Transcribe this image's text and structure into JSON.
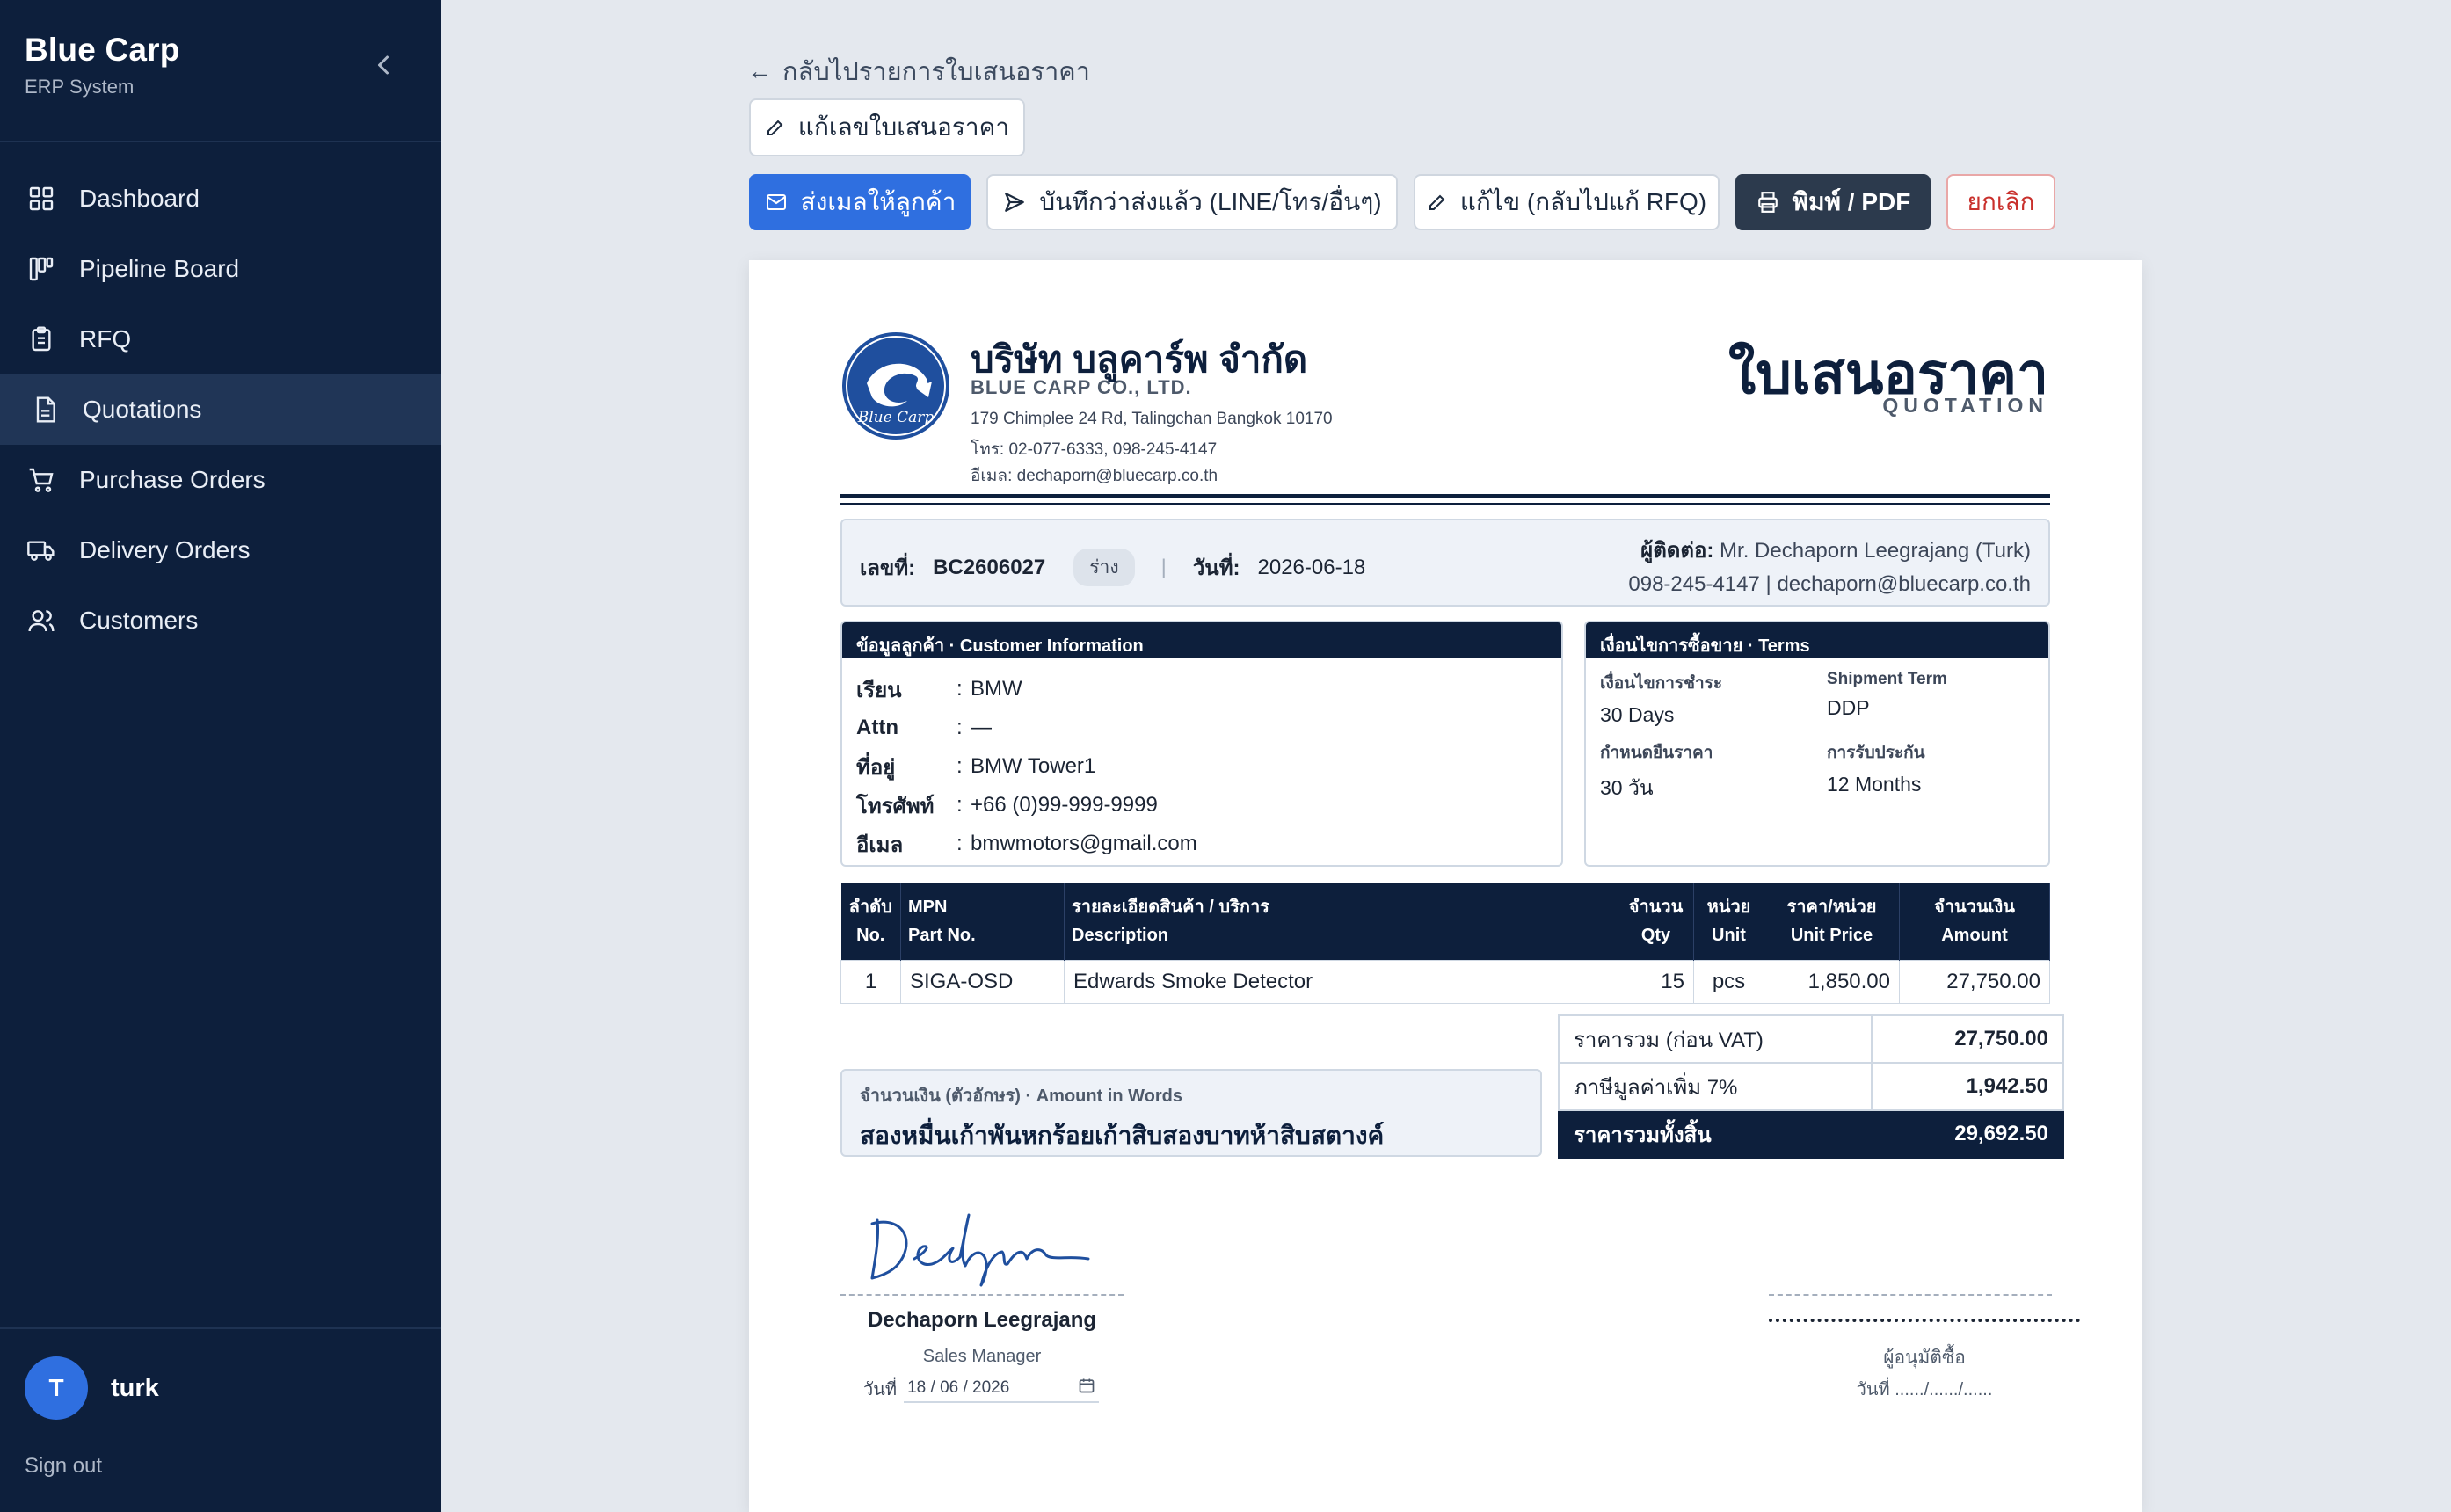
{
  "sidebar": {
    "brand": "Blue Carp",
    "subtitle": "ERP System",
    "items": [
      {
        "label": "Dashboard",
        "icon": "grid-icon"
      },
      {
        "label": "Pipeline Board",
        "icon": "kanban-icon"
      },
      {
        "label": "RFQ",
        "icon": "clipboard-icon"
      },
      {
        "label": "Quotations",
        "icon": "document-icon",
        "active": true
      },
      {
        "label": "Purchase Orders",
        "icon": "cart-icon"
      },
      {
        "label": "Delivery Orders",
        "icon": "truck-icon"
      },
      {
        "label": "Customers",
        "icon": "users-icon"
      }
    ],
    "user": {
      "initial": "T",
      "name": "turk"
    },
    "sign_out": "Sign out"
  },
  "toolbar": {
    "back": "กลับไปรายการใบเสนอราคา",
    "edit_number": "แก้เลขใบเสนอราคา",
    "send_email": "ส่งเมลให้ลูกค้า",
    "mark_sent": "บันทึกว่าส่งแล้ว (LINE/โทร/อื่นๆ)",
    "revise": "แก้ไข (กลับไปแก้ RFQ)",
    "print": "พิมพ์ / PDF",
    "cancel": "ยกเลิก"
  },
  "colors": {
    "navy": "#0d1f3c",
    "primary": "#2f6fe0",
    "danger": "#c9302c"
  },
  "company": {
    "logo_text": "Blue Carp",
    "name_th": "บริษัท บลูคาร์พ จำกัด",
    "name_en": "BLUE CARP CO., LTD.",
    "address": "179 Chimplee 24 Rd, Talingchan Bangkok 10170",
    "phone": "โทร: 02-077-6333, 098-245-4147",
    "email": "อีเมล: dechaporn@bluecarp.co.th"
  },
  "document": {
    "title_th": "ใบเสนอราคา",
    "title_en": "QUOTATION"
  },
  "meta": {
    "no_label": "เลขที่:",
    "no": "BC2606027",
    "status": "ร่าง",
    "date_label": "วันที่:",
    "date": "2026-06-18",
    "contact_label": "ผู้ติดต่อ:",
    "contact_name": "Mr. Dechaporn Leegrajang (Turk)",
    "contact_phone": "098-245-4147",
    "contact_sep": "|",
    "contact_email": "dechaporn@bluecarp.co.th"
  },
  "customer": {
    "heading": "ข้อมูลลูกค้า · Customer Information",
    "rows": [
      {
        "k": "เรียน",
        "v": "BMW"
      },
      {
        "k": "Attn",
        "v": "—"
      },
      {
        "k": "ที่อยู่",
        "v": "BMW Tower1"
      },
      {
        "k": "โทรศัพท์",
        "v": "+66 (0)99-999-9999"
      },
      {
        "k": "อีเมล",
        "v": "bmwmotors@gmail.com"
      }
    ]
  },
  "terms": {
    "heading": "เงื่อนไขการซื้อขาย · Terms",
    "payment_label": "เงื่อนไขการชำระ",
    "payment": "30 Days",
    "shipment_label": "Shipment Term",
    "shipment": "DDP",
    "validity_label": "กำหนดยืนราคา",
    "validity": "30 วัน",
    "warranty_label": "การรับประกัน",
    "warranty": "12 Months"
  },
  "items": {
    "headers": [
      {
        "th": "ลำดับ",
        "en": "No."
      },
      {
        "th": "MPN",
        "en": "Part No."
      },
      {
        "th": "รายละเอียดสินค้า / บริการ",
        "en": "Description"
      },
      {
        "th": "จำนวน",
        "en": "Qty"
      },
      {
        "th": "หน่วย",
        "en": "Unit"
      },
      {
        "th": "ราคา/หน่วย",
        "en": "Unit Price"
      },
      {
        "th": "จำนวนเงิน",
        "en": "Amount"
      }
    ],
    "rows": [
      {
        "no": "1",
        "mpn": "SIGA-OSD",
        "desc": "Edwards Smoke Detector",
        "qty": "15",
        "unit": "pcs",
        "price": "1,850.00",
        "amount": "27,750.00"
      }
    ]
  },
  "words": {
    "label": "จำนวนเงิน (ตัวอักษร) · Amount in Words",
    "value": "สองหมื่นเก้าพันหกร้อยเก้าสิบสองบาทห้าสิบสตางค์"
  },
  "totals": {
    "subtotal_label": "ราคารวม (ก่อน VAT)",
    "subtotal": "27,750.00",
    "vat_label": "ภาษีมูลค่าเพิ่ม 7%",
    "vat": "1,942.50",
    "grand_label": "ราคารวมทั้งสิ้น",
    "grand": "29,692.50"
  },
  "signature": {
    "script": "Dechaporn",
    "name": "Dechaporn Leegrajang",
    "role": "Sales Manager",
    "date_label": "วันที่",
    "date_value": "18 / 06 / 2026",
    "approver_label": "ผู้อนุมัติซื้อ",
    "approver_date": "วันที่ ....../....../......"
  }
}
